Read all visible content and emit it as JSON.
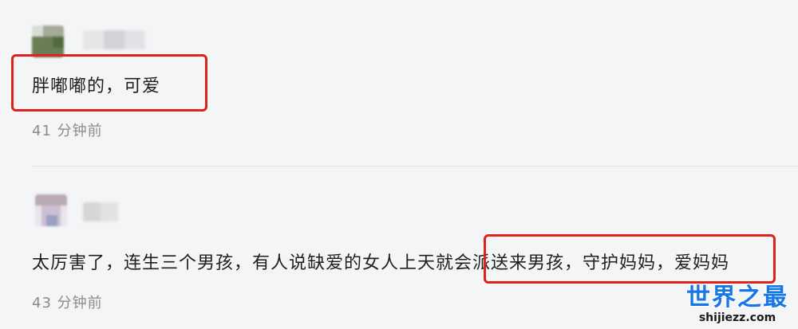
{
  "comments": [
    {
      "text": "胖嘟嘟的，可爱",
      "time": "41 分钟前"
    },
    {
      "text": "太厉害了，连生三个男孩，有人说缺爱的女人上天就会派送来男孩，守护妈妈，爱妈妈",
      "time": "43 分钟前"
    }
  ],
  "watermark": {
    "title": "世界之最",
    "url": "shijiezz.com"
  },
  "colors": {
    "highlight": "#e0221c",
    "watermark": "#1677e5",
    "timestamp": "#8c8c8c"
  }
}
